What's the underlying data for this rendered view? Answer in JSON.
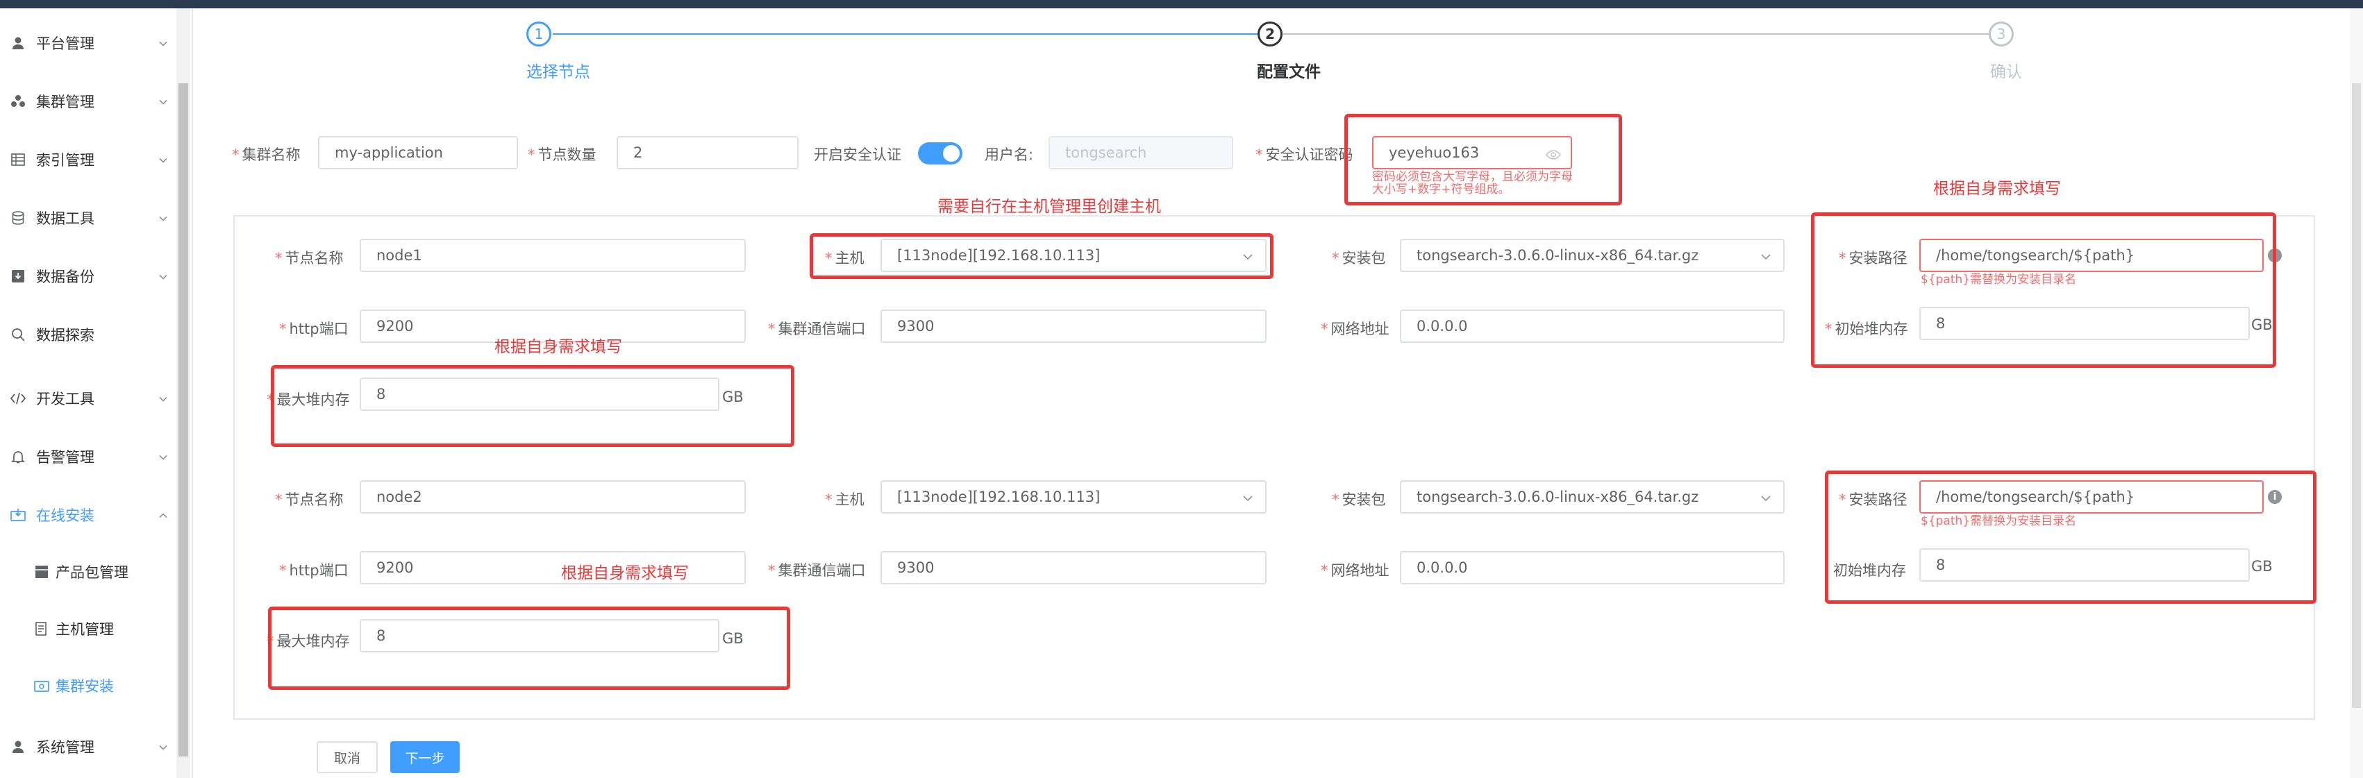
{
  "sidebar": {
    "items": [
      {
        "label": "平台管理",
        "icon": "user-icon"
      },
      {
        "label": "集群管理",
        "icon": "cluster-icon"
      },
      {
        "label": "索引管理",
        "icon": "index-icon"
      },
      {
        "label": "数据工具",
        "icon": "database-icon"
      },
      {
        "label": "数据备份",
        "icon": "backup-icon"
      },
      {
        "label": "数据探索",
        "icon": "search-icon"
      },
      {
        "label": "开发工具",
        "icon": "code-icon"
      },
      {
        "label": "告警管理",
        "icon": "bell-icon"
      },
      {
        "label": "在线安装",
        "icon": "install-icon",
        "expanded": true
      },
      {
        "label": "产品包管理",
        "icon": "package-icon"
      },
      {
        "label": "主机管理",
        "icon": "host-icon"
      },
      {
        "label": "集群安装",
        "icon": "cluster-install-icon",
        "active": true
      },
      {
        "label": "系统管理",
        "icon": "user-icon"
      }
    ]
  },
  "steps": [
    {
      "number": "1",
      "title": "选择节点",
      "status": "done"
    },
    {
      "number": "2",
      "title": "配置文件",
      "status": "process"
    },
    {
      "number": "3",
      "title": "确认",
      "status": "wait"
    }
  ],
  "form": {
    "cluster_name_label": "集群名称",
    "cluster_name_value": "my-application",
    "node_count_label": "节点数量",
    "node_count_value": "2",
    "security_label": "开启安全认证",
    "security_enabled": true,
    "username_label": "用户名:",
    "username_placeholder": "tongsearch",
    "password_label": "安全认证密码",
    "password_value": "yeyehuo163",
    "password_error": "密码必须包含大写字母，且必须为字母大小写+数字+符号组成。"
  },
  "nodes": [
    {
      "name_label": "节点名称",
      "name_value": "node1",
      "host_label": "主机",
      "host_value": "[113node][192.168.10.113]",
      "package_label": "安装包",
      "package_value": "tongsearch-3.0.6.0-linux-x86_64.tar.gz",
      "path_label": "安装路径",
      "path_value": "/home/tongsearch/${path}",
      "path_hint": "${path}需替换为安装目录名",
      "http_label": "http端口",
      "http_value": "9200",
      "transport_label": "集群通信端口",
      "transport_value": "9300",
      "network_label": "网络地址",
      "network_value": "0.0.0.0",
      "init_heap_label": "初始堆内存",
      "init_heap_value": "8",
      "max_heap_label": "最大堆内存",
      "max_heap_value": "8",
      "unit": "GB"
    },
    {
      "name_label": "节点名称",
      "name_value": "node2",
      "host_label": "主机",
      "host_value": "[113node][192.168.10.113]",
      "package_label": "安装包",
      "package_value": "tongsearch-3.0.6.0-linux-x86_64.tar.gz",
      "path_label": "安装路径",
      "path_value": "/home/tongsearch/${path}",
      "path_hint": "${path}需替换为安装目录名",
      "http_label": "http端口",
      "http_value": "9200",
      "transport_label": "集群通信端口",
      "transport_value": "9300",
      "network_label": "网络地址",
      "network_value": "0.0.0.0",
      "init_heap_label": "初始堆内存",
      "init_heap_value": "8",
      "max_heap_label": "最大堆内存",
      "max_heap_value": "8",
      "unit": "GB"
    }
  ],
  "annotations": {
    "host_note": "需要自行在主机管理里创建主机",
    "self_fill": "根据自身需求填写"
  },
  "buttons": {
    "cancel": "取消",
    "next": "下一步"
  },
  "colors": {
    "primary": "#409eff",
    "annotation_red": "#e83838",
    "error": "#f56c6c"
  }
}
